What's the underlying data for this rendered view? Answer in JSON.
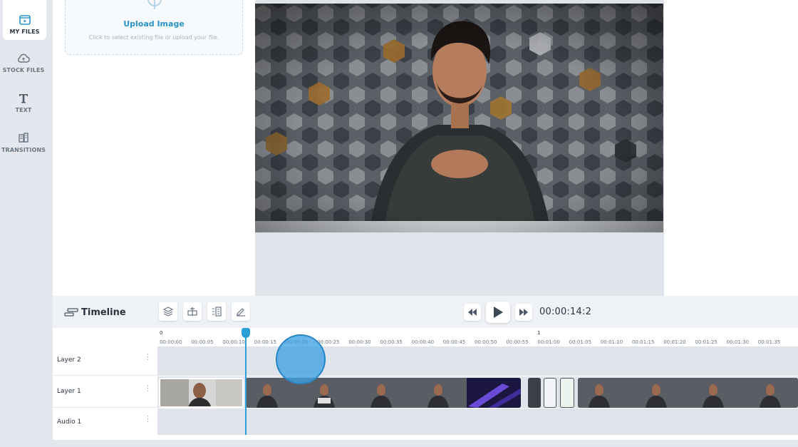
{
  "nav": {
    "items": [
      {
        "label": "MY FILES",
        "icon": "my-files-icon",
        "active": true
      },
      {
        "label": "STOCK FILES",
        "icon": "cloud-icon",
        "active": false
      },
      {
        "label": "TEXT",
        "icon": "text-icon",
        "active": false
      },
      {
        "label": "TRANSITIONS",
        "icon": "transitions-icon",
        "active": false
      }
    ]
  },
  "upload": {
    "title": "Upload Image",
    "subtitle": "Click to select existing file or upload your file."
  },
  "timeline": {
    "title": "Timeline",
    "timecode": "00:00:14:2",
    "ruler_marks": [
      "0",
      "1"
    ],
    "ruler_labels": [
      "00:00:00",
      "00:00:05",
      "00:00:10",
      "00:00:15",
      "00:00:20",
      "00:00:25",
      "00:00:30",
      "00:00:35",
      "00:00:40",
      "00:00:45",
      "00:00:50",
      "00:00:55",
      "00:01:00",
      "00:01:05",
      "00:01:10",
      "00:01:15",
      "00:01:20",
      "00:01:25",
      "00:01:30",
      "00:01:35"
    ],
    "layers": [
      "Layer 2",
      "Layer 1",
      "Audio 1"
    ]
  },
  "colors": {
    "accent": "#2a9fd8",
    "nav_bg": "#e4e8ee",
    "track_bg": "#dfe4ea"
  }
}
